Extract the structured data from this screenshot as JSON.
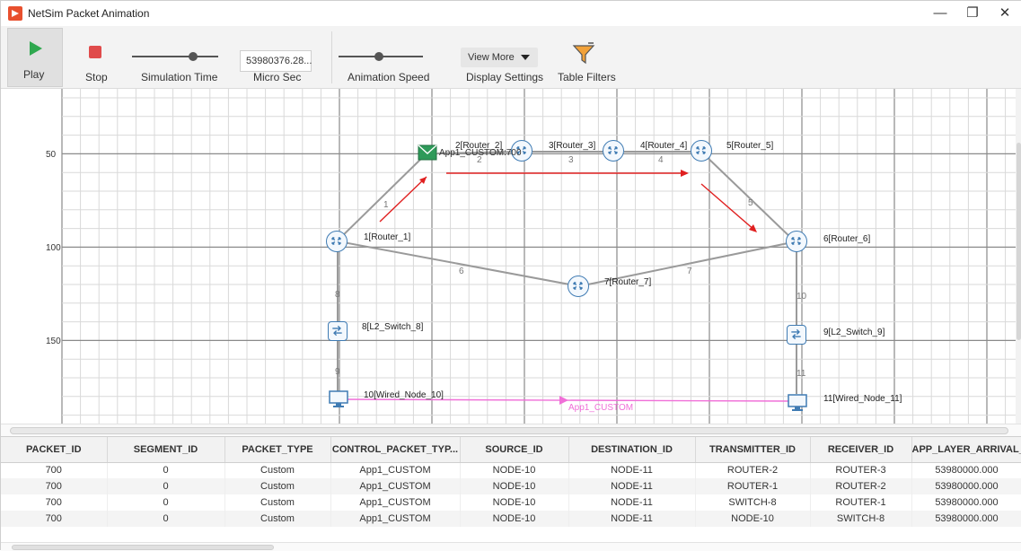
{
  "window": {
    "title": "NetSim Packet Animation",
    "minimize": "—",
    "restore": "❐",
    "close": "✕"
  },
  "toolbar": {
    "play_label": "Play",
    "stop_label": "Stop",
    "sim_time_label": "Simulation Time",
    "micro_sec_value": "53980376.28...",
    "micro_sec_label": "Micro Sec",
    "anim_speed_label": "Animation Speed",
    "view_more_label": "View More",
    "display_settings_label": "Display Settings",
    "table_filters_label": "Table Filters",
    "sim_time_slider_level": 0.71,
    "anim_speed_slider_level": 0.48
  },
  "canvas": {
    "y_axis_labels": [
      "50",
      "100",
      "150"
    ],
    "nodes": [
      {
        "label": "1[Router_1]"
      },
      {
        "label": "2[Router_2]"
      },
      {
        "label": "3[Router_3]"
      },
      {
        "label": "4[Router_4]"
      },
      {
        "label": "5[Router_5]"
      },
      {
        "label": "6[Router_6]"
      },
      {
        "label": "7[Router_7]"
      },
      {
        "label": "8[L2_Switch_8]"
      },
      {
        "label": "9[L2_Switch_9]"
      },
      {
        "label": "10[Wired_Node_10]"
      },
      {
        "label": "11[Wired_Node_11]"
      }
    ],
    "link_labels": [
      "1",
      "2",
      "3",
      "4",
      "5",
      "6",
      "7",
      "8",
      "9",
      "10",
      "11"
    ],
    "packet_tag": "App1_CUSTOM:700",
    "app_label": "App1_CUSTOM",
    "colors": {
      "grid": "#d9d9d9",
      "grid_major": "#8a8a8a",
      "link": "#9a9a9a",
      "arrow": "#e02020",
      "app_flow": "#f06fd8",
      "router_border": "#3f7bb3"
    }
  },
  "table": {
    "columns": [
      "PACKET_ID",
      "SEGMENT_ID",
      "PACKET_TYPE",
      "CONTROL_PACKET_TYP...",
      "SOURCE_ID",
      "DESTINATION_ID",
      "TRANSMITTER_ID",
      "RECEIVER_ID",
      "APP_LAYER_ARRIVAL_T..."
    ],
    "rows": [
      [
        "700",
        "0",
        "Custom",
        "App1_CUSTOM",
        "NODE-10",
        "NODE-11",
        "ROUTER-2",
        "ROUTER-3",
        "53980000.000"
      ],
      [
        "700",
        "0",
        "Custom",
        "App1_CUSTOM",
        "NODE-10",
        "NODE-11",
        "ROUTER-1",
        "ROUTER-2",
        "53980000.000"
      ],
      [
        "700",
        "0",
        "Custom",
        "App1_CUSTOM",
        "NODE-10",
        "NODE-11",
        "SWITCH-8",
        "ROUTER-1",
        "53980000.000"
      ],
      [
        "700",
        "0",
        "Custom",
        "App1_CUSTOM",
        "NODE-10",
        "NODE-11",
        "NODE-10",
        "SWITCH-8",
        "53980000.000"
      ]
    ]
  }
}
